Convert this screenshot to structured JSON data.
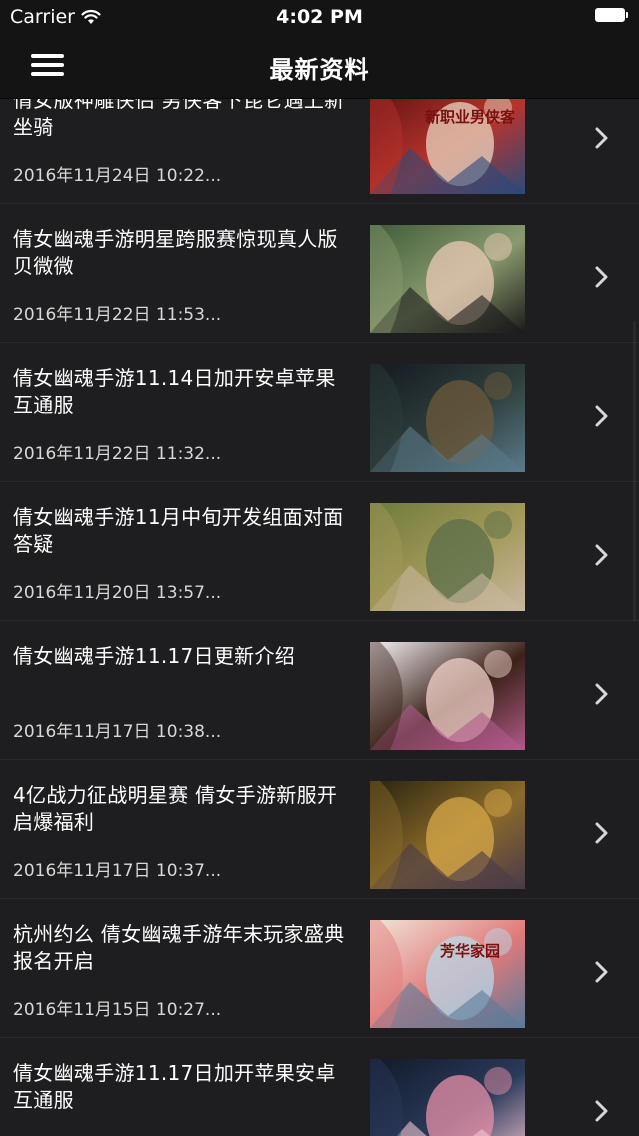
{
  "status_bar": {
    "carrier": "Carrier",
    "time": "4:02 PM",
    "wifi_icon": "wifi-icon",
    "battery_icon": "battery-full-icon"
  },
  "nav": {
    "title": "最新资料",
    "menu_icon": "hamburger-menu-icon"
  },
  "articles": [
    {
      "title": "倩女版神雕侠侣 男侠客下昆仑遇上新坐骑",
      "date": "2016年11月24日 10:22...",
      "thumbnail_text": "新职业男侠客",
      "thumbnail_palette": [
        "#5a1010",
        "#b8342c",
        "#e8d6c0",
        "#2c4a7a"
      ]
    },
    {
      "title": "倩女幽魂手游明星跨服赛惊现真人版贝微微",
      "date": "2016年11月22日 11:53...",
      "thumbnail_palette": [
        "#3f5c3a",
        "#8a9a6e",
        "#e9c9b6",
        "#1a1a1a"
      ]
    },
    {
      "title": "倩女幽魂手游11.14日加开安卓苹果互通服",
      "date": "2016年11月22日 11:32...",
      "thumbnail_palette": [
        "#141a22",
        "#2f3f3c",
        "#6e5a3a",
        "#5a7a8a"
      ]
    },
    {
      "title": "倩女幽魂手游11月中旬开发组面对面答疑",
      "date": "2016年11月20日 13:57...",
      "thumbnail_palette": [
        "#6e7a3a",
        "#a39a5a",
        "#5a6e4a",
        "#c8b8a0"
      ]
    },
    {
      "title": "倩女幽魂手游11.17日更新介绍",
      "date": "2016年11月17日 10:38...",
      "thumbnail_palette": [
        "#f4f1f5",
        "#3a2218",
        "#f2d2c8",
        "#b05a8a"
      ]
    },
    {
      "title": "4亿战力征战明星赛 倩女手游新服开启爆福利",
      "date": "2016年11月17日 10:37...",
      "thumbnail_palette": [
        "#2a2410",
        "#8a6a2a",
        "#d8a84a",
        "#4a3a4a"
      ]
    },
    {
      "title": "杭州约么 倩女幽魂手游年末玩家盛典报名开启",
      "date": "2016年11月15日 10:27...",
      "thumbnail_text": "芳华家园",
      "thumbnail_palette": [
        "#f0e4d6",
        "#e07a7a",
        "#b8d8e8",
        "#5a7a9a"
      ]
    },
    {
      "title": "倩女幽魂手游11.17日加开苹果安卓互通服",
      "date": "",
      "thumbnail_palette": [
        "#121a2a",
        "#2a3a5a",
        "#e890a8",
        "#f4c4d0"
      ]
    }
  ],
  "row_chevron_icon": "chevron-right-icon"
}
